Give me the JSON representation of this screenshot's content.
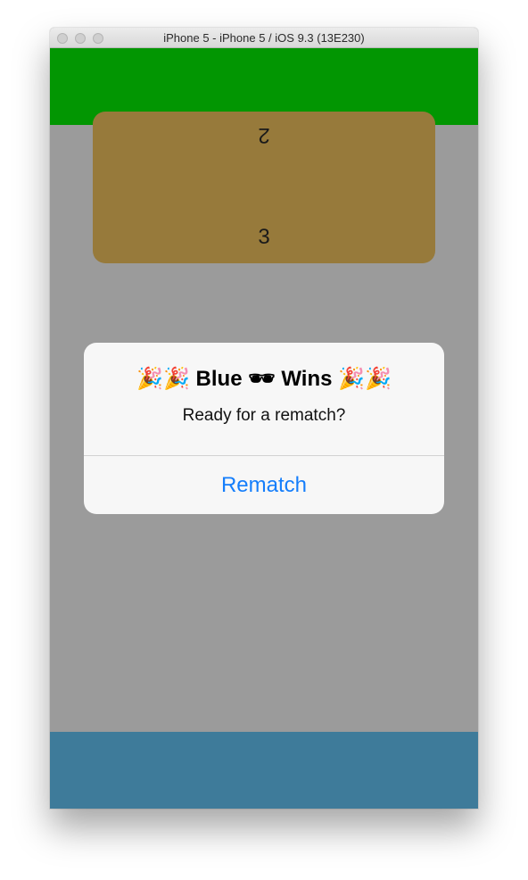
{
  "window": {
    "title": "iPhone 5 - iPhone 5 / iOS 9.3 (13E230)"
  },
  "colors": {
    "top_player": "#029602",
    "bottom_player": "#3e7b9a",
    "board": "#9b9b9b",
    "score_card": "#977a3b",
    "alert_button": "#157efb"
  },
  "score": {
    "top": "2",
    "bottom": "3"
  },
  "alert": {
    "title": "🎉🎉 Blue 🕶 Wins 🎉🎉",
    "message": "Ready for a rematch?",
    "button_label": "Rematch"
  }
}
